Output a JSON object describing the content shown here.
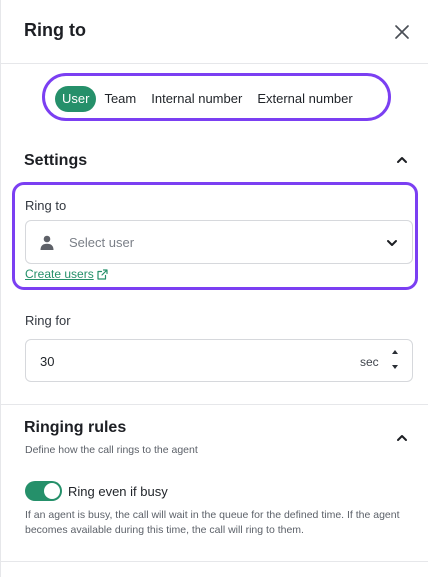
{
  "header": {
    "title": "Ring to",
    "close_icon": "close-icon"
  },
  "tabs": [
    {
      "label": "User",
      "active": true
    },
    {
      "label": "Team",
      "active": false
    },
    {
      "label": "Internal number",
      "active": false
    },
    {
      "label": "External number",
      "active": false
    }
  ],
  "settings": {
    "title": "Settings",
    "collapse_icon": "chevron-up-icon",
    "ring_to": {
      "label": "Ring to",
      "placeholder": "Select user",
      "leading_icon": "user-icon",
      "trailing_icon": "chevron-down-icon",
      "create_link": "Create users",
      "create_link_icon": "external-link-icon"
    },
    "ring_for": {
      "label": "Ring for",
      "value": "30",
      "unit": "sec"
    }
  },
  "ringing_rules": {
    "title": "Ringing rules",
    "description": "Define how the call rings to the agent",
    "collapse_icon": "chevron-up-icon",
    "toggle": {
      "label": "Ring even if busy",
      "on": true
    },
    "help_text": "If an agent is busy, the call will wait in the queue for the defined time. If the agent becomes available during this time, the call will ring to them."
  },
  "colors": {
    "accent": "#25906a",
    "highlight": "#7b3ff2",
    "border": "#d6d8dc"
  }
}
